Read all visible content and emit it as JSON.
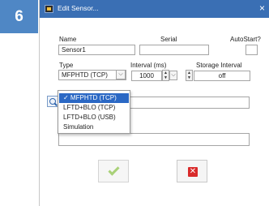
{
  "step": {
    "number": "6"
  },
  "window": {
    "title": "Edit Sensor...",
    "close_glyph": "×"
  },
  "form": {
    "name_label": "Name",
    "name_value": "Sensor1",
    "serial_label": "Serial",
    "serial_value": "",
    "autostart_label": "AutoStart?",
    "type_label": "Type",
    "type_value": "MFPHTD (TCP)",
    "interval_label": "Interval (ms)",
    "interval_value": "1000",
    "storage_label": "Storage Interval",
    "storage_value": "off",
    "extra_field_1": "",
    "extra_field_2": ""
  },
  "type_dropdown": {
    "options": [
      {
        "label": "✓ MFPHTD (TCP)",
        "selected": true
      },
      {
        "label": "LFTD+BLO (TCP)",
        "selected": false
      },
      {
        "label": "LFTD+BLO (USB)",
        "selected": false
      },
      {
        "label": "Simulation",
        "selected": false
      }
    ]
  },
  "icons": {
    "search": "search-icon",
    "ok": "check-icon",
    "cancel": "cancel-icon",
    "close": "close-icon"
  },
  "colors": {
    "accent": "#3a6fb4",
    "badge": "#4f87c5",
    "selection": "#2b68c4",
    "ok": "#a9d178",
    "cancel": "#d92b2b"
  }
}
